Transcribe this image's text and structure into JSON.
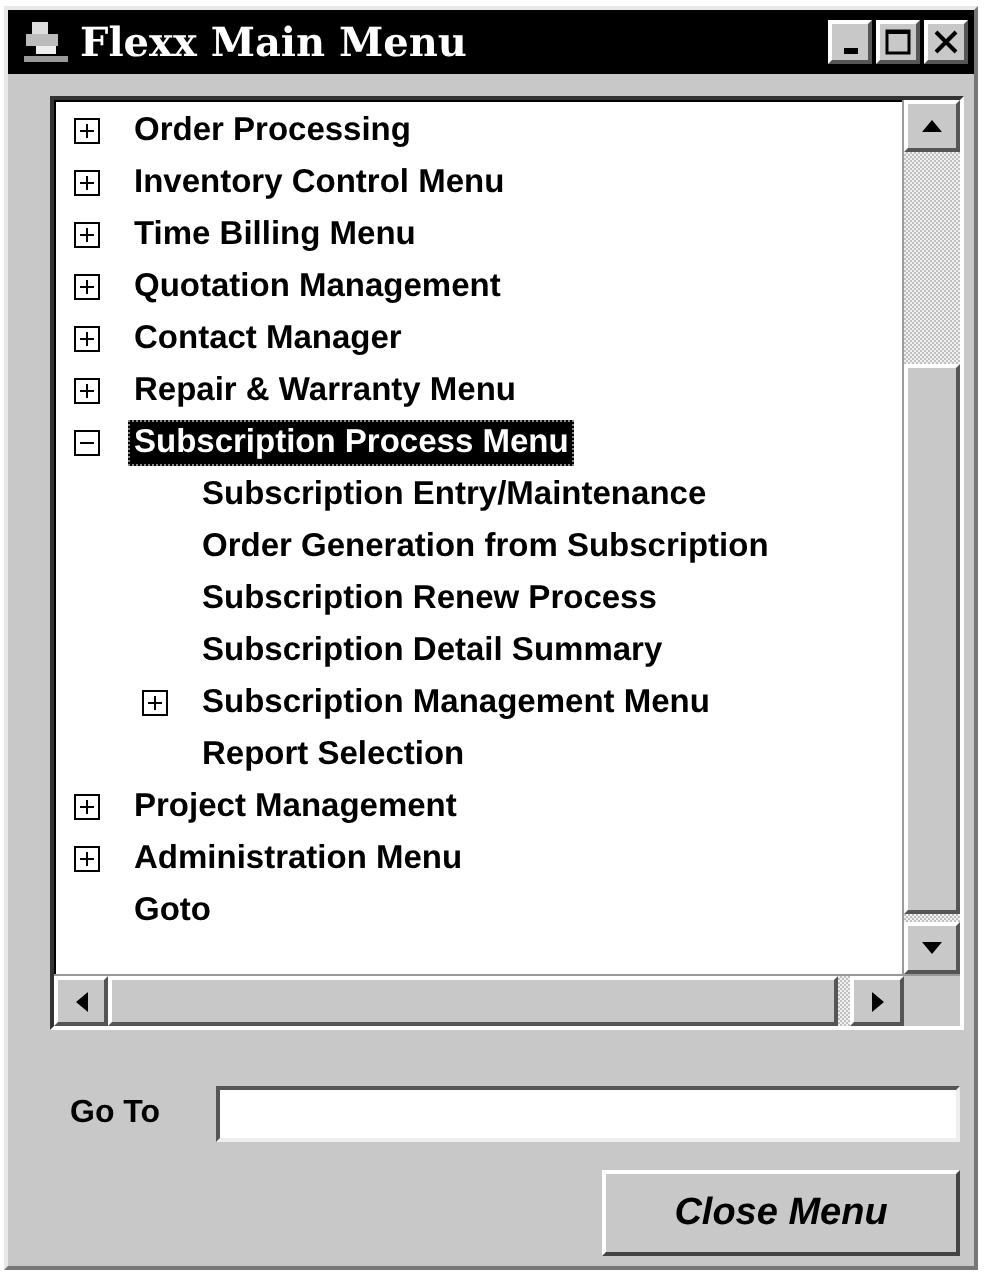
{
  "window": {
    "title": "Flexx Main Menu"
  },
  "tree": [
    {
      "label": "Order Processing",
      "kind": "branch",
      "expanded": false,
      "selected": false
    },
    {
      "label": "Inventory Control Menu",
      "kind": "branch",
      "expanded": false,
      "selected": false
    },
    {
      "label": "Time Billing Menu",
      "kind": "branch",
      "expanded": false,
      "selected": false
    },
    {
      "label": "Quotation Management",
      "kind": "branch",
      "expanded": false,
      "selected": false
    },
    {
      "label": "Contact Manager",
      "kind": "branch",
      "expanded": false,
      "selected": false
    },
    {
      "label": "Repair & Warranty Menu",
      "kind": "branch",
      "expanded": false,
      "selected": false
    },
    {
      "label": "Subscription Process Menu",
      "kind": "branch",
      "expanded": true,
      "selected": true,
      "children": [
        {
          "label": "Subscription Entry/Maintenance",
          "kind": "leaf",
          "selected": false
        },
        {
          "label": "Order Generation from Subscription",
          "kind": "leaf",
          "selected": false
        },
        {
          "label": "Subscription Renew Process",
          "kind": "leaf",
          "selected": false
        },
        {
          "label": "Subscription Detail Summary",
          "kind": "leaf",
          "selected": false
        },
        {
          "label": "Subscription Management Menu",
          "kind": "branch",
          "expanded": false,
          "selected": false
        },
        {
          "label": "Report Selection",
          "kind": "leaf",
          "selected": false
        }
      ]
    },
    {
      "label": "Project Management",
      "kind": "branch",
      "expanded": false,
      "selected": false
    },
    {
      "label": "Administration Menu",
      "kind": "branch",
      "expanded": false,
      "selected": false
    },
    {
      "label": "Goto",
      "kind": "leaf",
      "selected": false
    }
  ],
  "goto_field": {
    "label": "Go To"
  },
  "close_button": {
    "label": "Close Menu"
  }
}
